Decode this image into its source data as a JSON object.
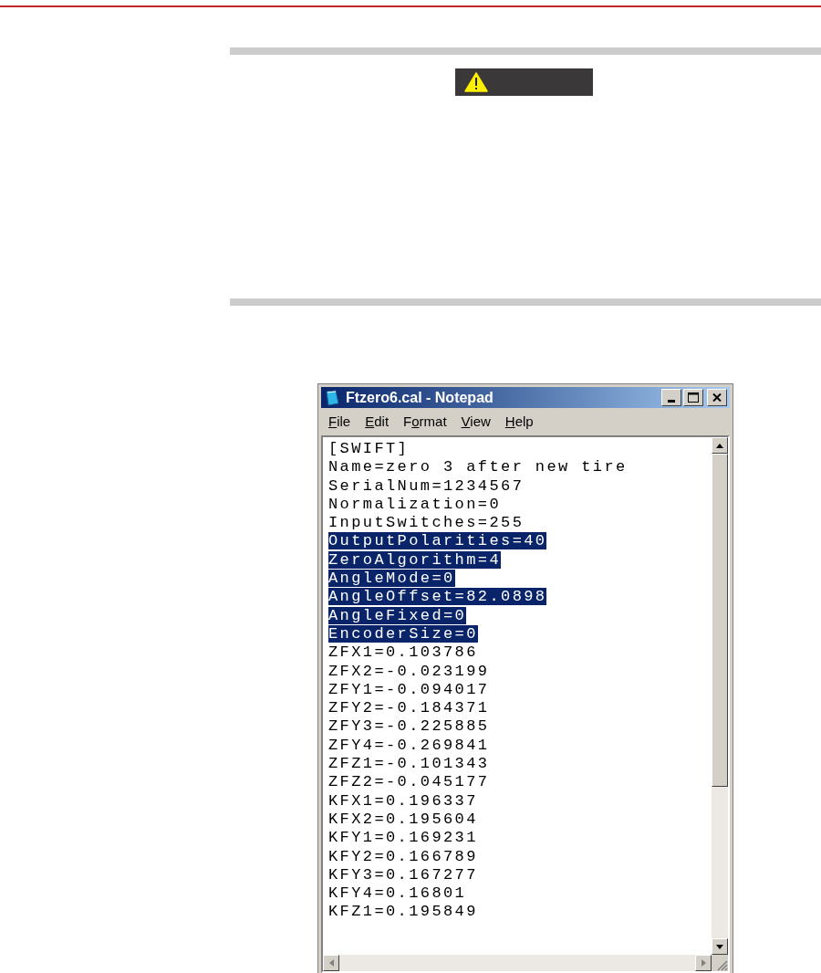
{
  "notepad": {
    "title": "Ftzero6.cal - Notepad",
    "menu": [
      {
        "access_key": "F",
        "rest": "ile"
      },
      {
        "access_key": "E",
        "rest": "dit"
      },
      {
        "lead": "F",
        "access_key": "o",
        "rest": "rmat"
      },
      {
        "access_key": "V",
        "rest": "iew"
      },
      {
        "access_key": "H",
        "rest": "elp"
      }
    ],
    "lines": [
      {
        "text": "[SWIFT]",
        "selected": false
      },
      {
        "text": "Name=zero 3 after new tire",
        "selected": false
      },
      {
        "text": "SerialNum=1234567",
        "selected": false
      },
      {
        "text": "Normalization=0",
        "selected": false
      },
      {
        "text": "InputSwitches=255",
        "selected": false
      },
      {
        "text": "OutputPolarities=40",
        "selected": true
      },
      {
        "text": "ZeroAlgorithm=4",
        "selected": true
      },
      {
        "text": "AngleMode=0",
        "selected": true
      },
      {
        "text": "AngleOffset=82.0898",
        "selected": true
      },
      {
        "text": "AngleFixed=0",
        "selected": true
      },
      {
        "text": "EncoderSize=0",
        "selected": true
      },
      {
        "text": "ZFX1=0.103786",
        "selected": false
      },
      {
        "text": "ZFX2=-0.023199",
        "selected": false
      },
      {
        "text": "ZFY1=-0.094017",
        "selected": false
      },
      {
        "text": "ZFY2=-0.184371",
        "selected": false
      },
      {
        "text": "ZFY3=-0.225885",
        "selected": false
      },
      {
        "text": "ZFY4=-0.269841",
        "selected": false
      },
      {
        "text": "ZFZ1=-0.101343",
        "selected": false
      },
      {
        "text": "ZFZ2=-0.045177",
        "selected": false
      },
      {
        "text": "KFX1=0.196337",
        "selected": false
      },
      {
        "text": "KFX2=0.195604",
        "selected": false
      },
      {
        "text": "KFY1=0.169231",
        "selected": false
      },
      {
        "text": "KFY2=0.166789",
        "selected": false
      },
      {
        "text": "KFY3=0.167277",
        "selected": false
      },
      {
        "text": "KFY4=0.16801",
        "selected": false
      },
      {
        "text": "KFZ1=0.195849",
        "selected": false
      }
    ]
  }
}
